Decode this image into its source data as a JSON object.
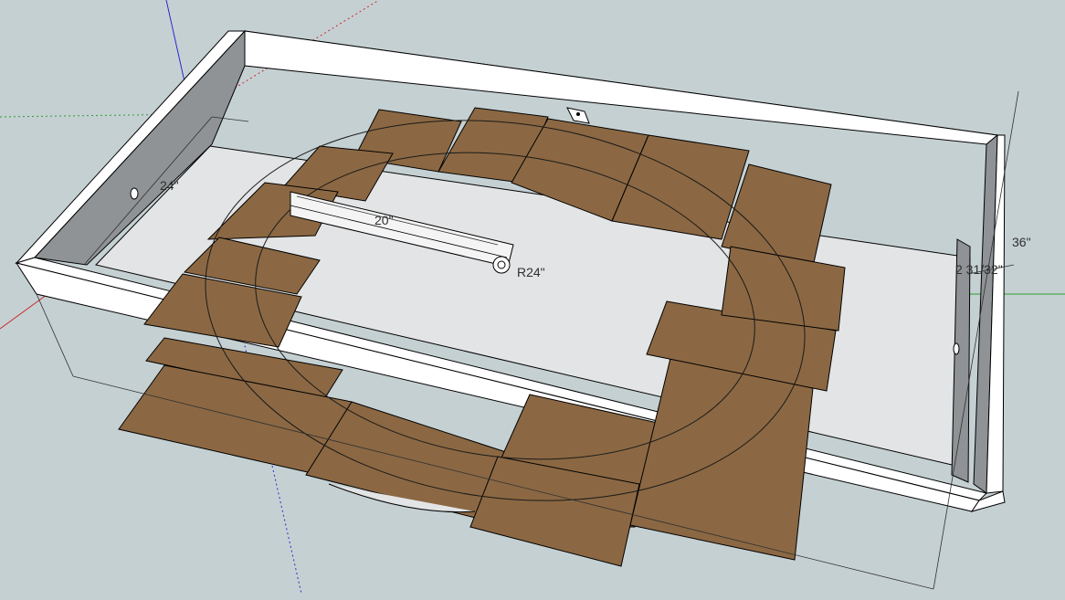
{
  "scene": {
    "background": "#c5d0d3",
    "board_color": "#8b6843",
    "frame_color": "#ffffff",
    "frame_shadow": "#8f9396",
    "axis_colors": {
      "red": "#cc2a2a",
      "green": "#2aa02a",
      "blue": "#2a2acc"
    }
  },
  "dimensions": {
    "frame_width": "24\"",
    "arm_length": "20\"",
    "circle_radius": "R24\"",
    "frame_height": "36\"",
    "side_dim": "2 31/32\""
  },
  "icons": [
    "protractor-icon"
  ]
}
